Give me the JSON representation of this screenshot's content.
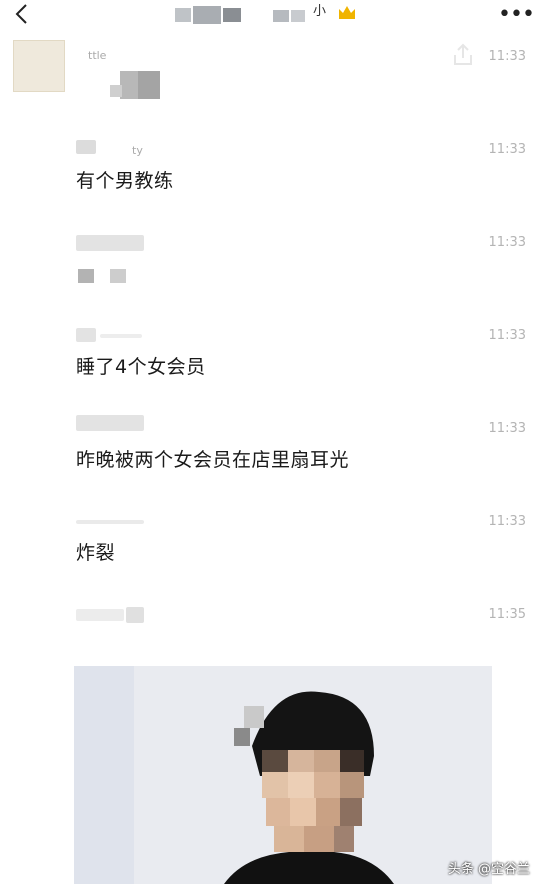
{
  "header": {
    "title_fragment": "小",
    "more_label": "•••"
  },
  "messages": [
    {
      "time": "11:33",
      "sender_fragment": "ttle",
      "text": ""
    },
    {
      "time": "11:33",
      "sender_fragment": "ty",
      "text": "有个男教练"
    },
    {
      "time": "11:33",
      "sender_fragment": "",
      "text": ""
    },
    {
      "time": "11:33",
      "sender_fragment": "",
      "text": "睡了4个女会员"
    },
    {
      "time": "11:33",
      "sender_fragment": "",
      "text": "昨晚被两个女会员在店里扇耳光"
    },
    {
      "time": "11:33",
      "sender_fragment": "",
      "text": "炸裂"
    },
    {
      "time": "11:35",
      "sender_fragment": "",
      "text": ""
    }
  ],
  "watermark": "头条 @空谷兰",
  "icons": {
    "back": "chevron-left-icon",
    "crown": "crown-icon",
    "share": "share-icon"
  },
  "colors": {
    "crown": "#f0b400",
    "time": "#b4b4b4"
  }
}
